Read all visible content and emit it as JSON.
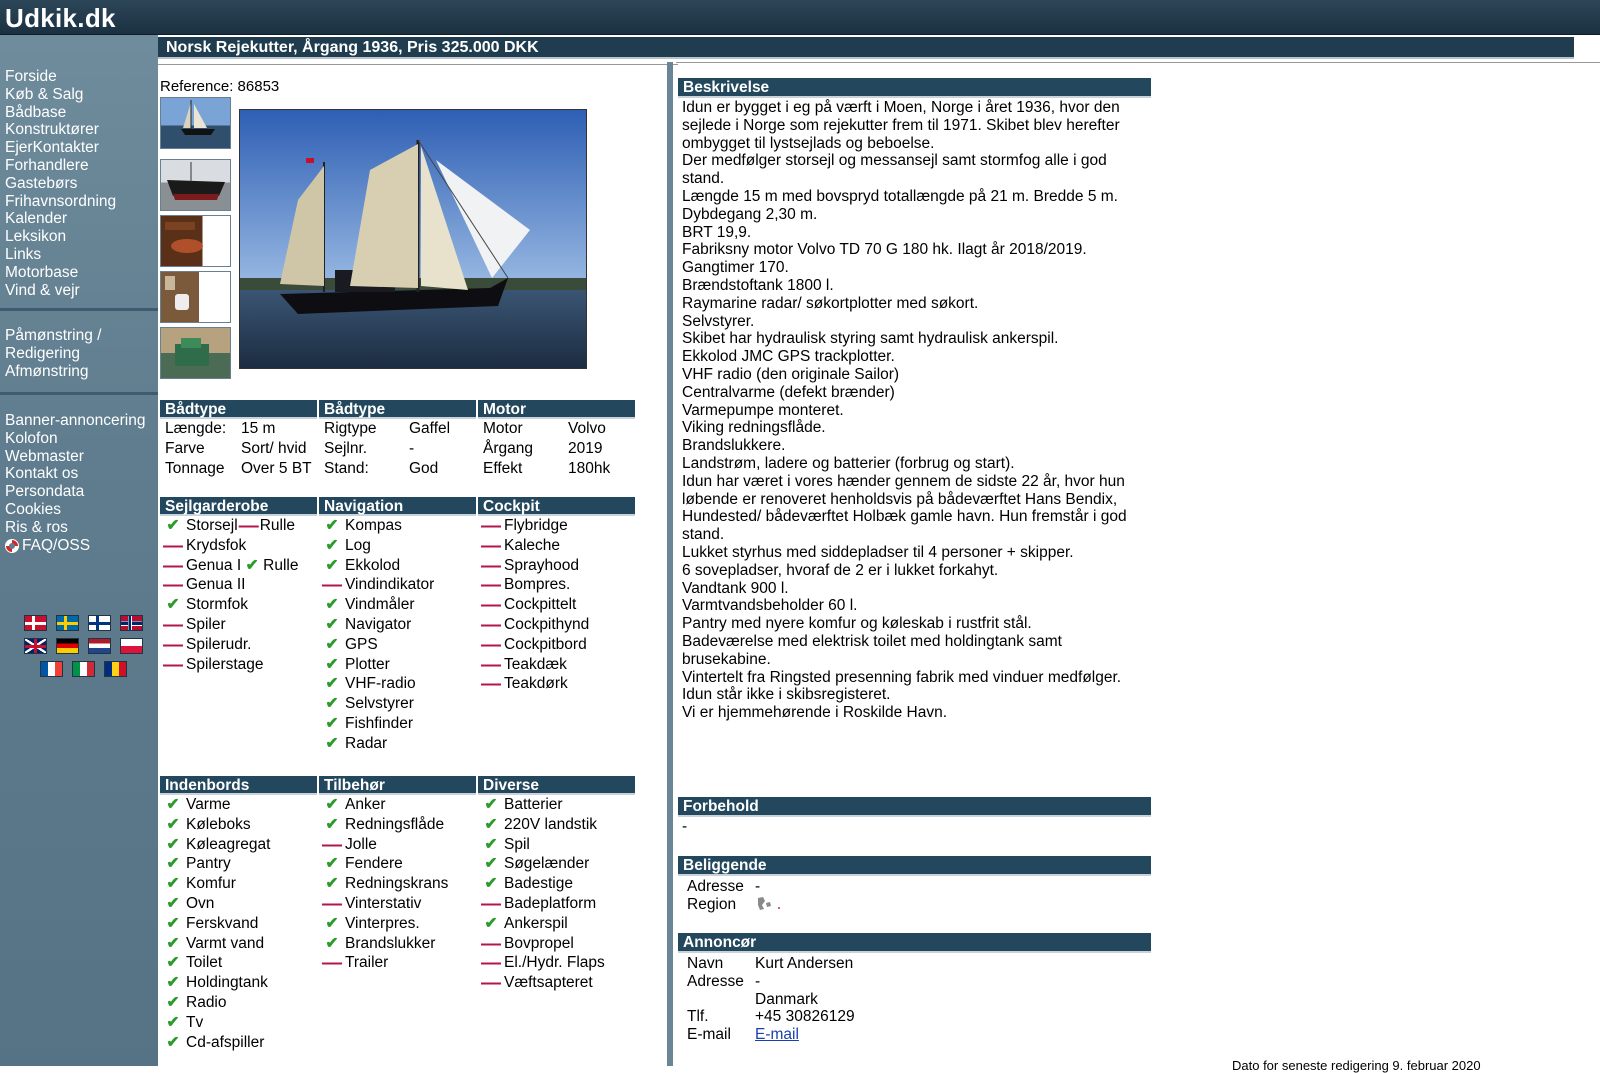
{
  "site": {
    "logo": "Udkik.dk"
  },
  "sidebar": {
    "nav": [
      "Forside",
      "Køb & Salg",
      "Bådbase",
      "Konstruktører",
      "EjerKontakter",
      "Forhandlere",
      "Gastebørs",
      "Frihavnsordning",
      "Kalender",
      "Leksikon",
      "Links",
      "Motorbase",
      "Vind & vejr"
    ],
    "account": [
      "Påmønstring /",
      "Redigering",
      "Afmønstring"
    ],
    "info": [
      "Banner-annoncering",
      "Kolofon",
      "Webmaster",
      "Kontakt os",
      "Persondata",
      "Cookies",
      "Ris & ros"
    ],
    "faq": "FAQ/OSS",
    "flags": [
      "Dansk",
      "Svenska",
      "Suomi",
      "Norsk",
      "English",
      "Deutsch",
      "Nederlands",
      "Polski",
      "Français",
      "Italiano",
      "Română"
    ]
  },
  "listing": {
    "title": "Norsk Rejekutter, Årgang 1936, Pris 325.000 DKK",
    "reference_label": "Reference:",
    "reference": "86853"
  },
  "specs": {
    "cols": [
      {
        "header": "Bådtype",
        "rows": [
          [
            "Længde:",
            "15 m"
          ],
          [
            "Farve",
            "Sort/ hvid"
          ],
          [
            "Tonnage",
            "Over 5 BT"
          ]
        ]
      },
      {
        "header": "Bådtype",
        "rows": [
          [
            "Rigtype",
            "Gaffel"
          ],
          [
            "Sejlnr.",
            "-"
          ],
          [
            "Stand:",
            "God"
          ]
        ]
      },
      {
        "header": "Motor",
        "rows": [
          [
            "Motor",
            "Volvo"
          ],
          [
            "Årgang",
            "2019"
          ],
          [
            "Effekt",
            "180hk"
          ]
        ]
      }
    ]
  },
  "equipment1": {
    "cols": [
      {
        "header": "Sejlgarderobe",
        "items": [
          {
            "label": "Storsejl",
            "ok": true,
            "extra_label": "Rulle",
            "extra_ok": false
          },
          {
            "label": "Krydsfok",
            "ok": false
          },
          {
            "label": "Genua I",
            "ok": false,
            "extra_label": "Rulle",
            "extra_ok": true
          },
          {
            "label": "Genua II",
            "ok": false
          },
          {
            "label": "Stormfok",
            "ok": true
          },
          {
            "label": "Spiler",
            "ok": false
          },
          {
            "label": "Spilerudr.",
            "ok": false
          },
          {
            "label": "Spilerstage",
            "ok": false
          }
        ]
      },
      {
        "header": "Navigation",
        "items": [
          {
            "label": "Kompas",
            "ok": true
          },
          {
            "label": "Log",
            "ok": true
          },
          {
            "label": "Ekkolod",
            "ok": true
          },
          {
            "label": "Vindindikator",
            "ok": false
          },
          {
            "label": "Vindmåler",
            "ok": true
          },
          {
            "label": "Navigator",
            "ok": true
          },
          {
            "label": "GPS",
            "ok": true
          },
          {
            "label": "Plotter",
            "ok": true
          },
          {
            "label": "VHF-radio",
            "ok": true
          },
          {
            "label": "Selvstyrer",
            "ok": true
          },
          {
            "label": "Fishfinder",
            "ok": true
          },
          {
            "label": "Radar",
            "ok": true
          }
        ]
      },
      {
        "header": "Cockpit",
        "items": [
          {
            "label": "Flybridge",
            "ok": false
          },
          {
            "label": "Kaleche",
            "ok": false
          },
          {
            "label": "Sprayhood",
            "ok": false
          },
          {
            "label": "Bompres.",
            "ok": false
          },
          {
            "label": "Cockpittelt",
            "ok": false
          },
          {
            "label": "Cockpithynd",
            "ok": false
          },
          {
            "label": "Cockpitbord",
            "ok": false
          },
          {
            "label": "Teakdæk",
            "ok": false
          },
          {
            "label": "Teakdørk",
            "ok": false
          }
        ]
      }
    ]
  },
  "equipment2": {
    "cols": [
      {
        "header": "Indenbords",
        "items": [
          {
            "label": "Varme",
            "ok": true
          },
          {
            "label": "Køleboks",
            "ok": true
          },
          {
            "label": "Køleagregat",
            "ok": true
          },
          {
            "label": "Pantry",
            "ok": true
          },
          {
            "label": "Komfur",
            "ok": true
          },
          {
            "label": "Ovn",
            "ok": true
          },
          {
            "label": "Ferskvand",
            "ok": true
          },
          {
            "label": "Varmt vand",
            "ok": true
          },
          {
            "label": "Toilet",
            "ok": true
          },
          {
            "label": "Holdingtank",
            "ok": true
          },
          {
            "label": "Radio",
            "ok": true
          },
          {
            "label": "Tv",
            "ok": true
          },
          {
            "label": "Cd-afspiller",
            "ok": true
          }
        ]
      },
      {
        "header": "Tilbehør",
        "items": [
          {
            "label": "Anker",
            "ok": true
          },
          {
            "label": "Redningsflåde",
            "ok": true
          },
          {
            "label": "Jolle",
            "ok": false
          },
          {
            "label": "Fendere",
            "ok": true
          },
          {
            "label": "Redningskrans",
            "ok": true
          },
          {
            "label": "Vinterstativ",
            "ok": false
          },
          {
            "label": "Vinterpres.",
            "ok": true
          },
          {
            "label": "Brandslukker",
            "ok": true
          },
          {
            "label": "Trailer",
            "ok": false
          }
        ]
      },
      {
        "header": "Diverse",
        "items": [
          {
            "label": "Batterier",
            "ok": true
          },
          {
            "label": "220V landstik",
            "ok": true
          },
          {
            "label": "Spil",
            "ok": true
          },
          {
            "label": "Søgelænder",
            "ok": true
          },
          {
            "label": "Badestige",
            "ok": true
          },
          {
            "label": "Badeplatform",
            "ok": false
          },
          {
            "label": "Ankerspil",
            "ok": true
          },
          {
            "label": "Bovpropel",
            "ok": false
          },
          {
            "label": "El./Hydr. Flaps",
            "ok": false
          },
          {
            "label": "Væftsapteret",
            "ok": false
          }
        ]
      }
    ]
  },
  "description": {
    "header": "Beskrivelse",
    "lines": [
      "Idun er bygget i eg på værft i Moen, Norge i året 1936, hvor den",
      "sejlede i Norge som rejekutter frem til 1971. Skibet blev herefter",
      "ombygget til lystsejlads og beboelse.",
      "Der medfølger storsejl og messansejl samt stormfog alle i god",
      "stand.",
      "Længde 15 m med bovspryd totallængde på 21 m. Bredde 5 m.",
      "Dybdegang 2,30 m.",
      "BRT 19,9.",
      "Fabriksny motor Volvo TD 70 G 180 hk. Ilagt år 2018/2019.",
      "Gangtimer 170.",
      "Brændstoftank 1800 l.",
      "Raymarine radar/ søkortplotter med søkort.",
      "Selvstyrer.",
      "Skibet har hydraulisk styring samt hydraulisk ankerspil.",
      "Ekkolod JMC GPS trackplotter.",
      "VHF radio (den originale Sailor)",
      "Centralvarme (defekt brænder)",
      "Varmepumpe monteret.",
      "Viking redningsflåde.",
      "Brandslukkere.",
      "Landstrøm, ladere og batterier (forbrug og start).",
      "Idun har været i vores hænder gennem de sidste 22 år, hvor hun",
      "løbende er renoveret henholdsvis på bådeværftet Hans Bendix,",
      "Hundested/ bådeværftet Holbæk gamle havn. Hun fremstår i god",
      "stand.",
      "Lukket styrhus med siddepladser til 4 personer + skipper.",
      "6 sovepladser, hvoraf de 2 er i lukket forkahyt.",
      "Vandtank 900 l.",
      "Varmtvandsbeholder 60 l.",
      "Pantry med nyere komfur og køleskab i rustfrit stål.",
      "Badeværelse med elektrisk toilet med holdingtank samt",
      "brusekabine.",
      "Vintertelt fra Ringsted presenning fabrik med vinduer medfølger.",
      "Idun står ikke i skibsregisteret.",
      "Vi er hjemmehørende i Roskilde Havn."
    ]
  },
  "reservations": {
    "header": "Forbehold",
    "text": "-"
  },
  "location": {
    "header": "Beliggende",
    "address_label": "Adresse",
    "address": "-",
    "region_label": "Region"
  },
  "advertiser": {
    "header": "Annoncør",
    "name_label": "Navn",
    "name": "Kurt Andersen",
    "address_label": "Adresse",
    "address": "-",
    "country": "Danmark",
    "phone_label": "Tlf.",
    "phone": "+45 30826129",
    "email_label": "E-mail",
    "email_link": "E-mail"
  },
  "footer": {
    "last_edit": "Dato for seneste redigering 9. februar 2020"
  },
  "colors": {
    "header_bg": "#23475c",
    "check": "#2c9a2c",
    "cross": "#b3174a",
    "sidebar": "#5f7d8e"
  }
}
